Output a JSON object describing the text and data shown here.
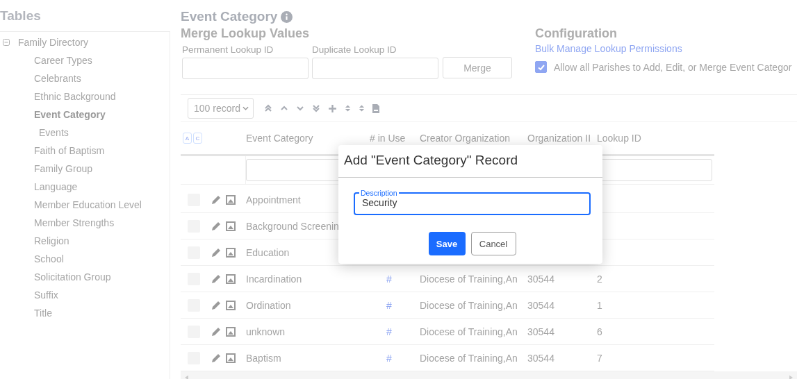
{
  "sidebar": {
    "title": "Tables",
    "tree": [
      {
        "label": "Family Directory",
        "expanded": true,
        "selected": false,
        "children": [
          {
            "label": "Career Types",
            "selected": false
          },
          {
            "label": "Celebrants",
            "selected": false
          },
          {
            "label": "Ethnic Background",
            "selected": false
          },
          {
            "label": "Event Category",
            "selected": true,
            "children": [
              {
                "label": "Events",
                "selected": false
              }
            ]
          },
          {
            "label": "Faith of Baptism",
            "selected": false
          },
          {
            "label": "Family Group",
            "selected": false
          },
          {
            "label": "Language",
            "selected": false
          },
          {
            "label": "Member Education Level",
            "selected": false
          },
          {
            "label": "Member Strengths",
            "selected": false
          },
          {
            "label": "Religion",
            "selected": false
          },
          {
            "label": "School",
            "selected": false
          },
          {
            "label": "Solicitation Group",
            "selected": false
          },
          {
            "label": "Suffix",
            "selected": false
          },
          {
            "label": "Title",
            "selected": false
          }
        ]
      }
    ]
  },
  "page_title": "Event Category",
  "merge": {
    "title": "Merge Lookup Values",
    "permanent_label": "Permanent Lookup ID",
    "duplicate_label": "Duplicate Lookup ID",
    "button": "Merge"
  },
  "configuration": {
    "title": "Configuration",
    "link": "Bulk Manage Lookup Permissions",
    "allow_all": {
      "label": "Allow all Parishes to Add, Edit, or Merge Event Categor",
      "checked": true
    }
  },
  "table": {
    "page_size": "100 record",
    "column_toggles": [
      "A",
      "C"
    ],
    "columns": [
      "Event Category",
      "# in Use",
      "Creator Organization",
      "Organization II",
      "Lookup ID"
    ],
    "rows": [
      {
        "checked": false,
        "name": "Appointment"
      },
      {
        "checked": false,
        "name": "Background Screenin"
      },
      {
        "checked": false,
        "name": "Education"
      },
      {
        "checked": false,
        "name": "Incardination",
        "in_use": "#",
        "creator": "Diocese of Training,An",
        "org_id": "30544",
        "lookup_id": "2"
      },
      {
        "checked": false,
        "name": "Ordination",
        "in_use": "#",
        "creator": "Diocese of Training,An",
        "org_id": "30544",
        "lookup_id": "1"
      },
      {
        "checked": false,
        "name": "unknown",
        "in_use": "#",
        "creator": "Diocese of Training,An",
        "org_id": "30544",
        "lookup_id": "6"
      },
      {
        "checked": false,
        "name": "Baptism",
        "in_use": "#",
        "creator": "Diocese of Training,An",
        "org_id": "30544",
        "lookup_id": "7"
      }
    ]
  },
  "dialog": {
    "title": "Add \"Event Category\" Record",
    "field_label": "Description",
    "field_value": "Security",
    "buttons": [
      "Save",
      "Cancel"
    ]
  }
}
